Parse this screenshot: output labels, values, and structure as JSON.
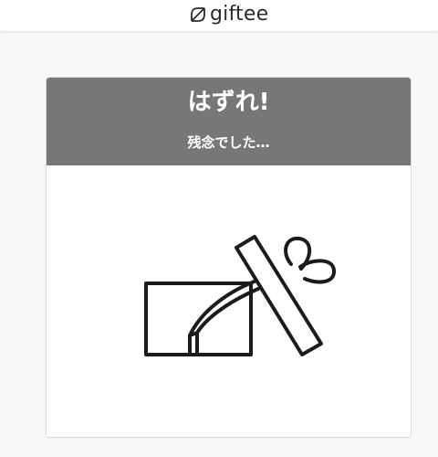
{
  "header": {
    "logo_text": "giftee",
    "logo_icon": "giftee-logo-icon"
  },
  "result": {
    "title": "はずれ!",
    "subtitle": "残念でした…",
    "header_color": "#777777",
    "illustration_icon": "open-gift-box-icon"
  }
}
